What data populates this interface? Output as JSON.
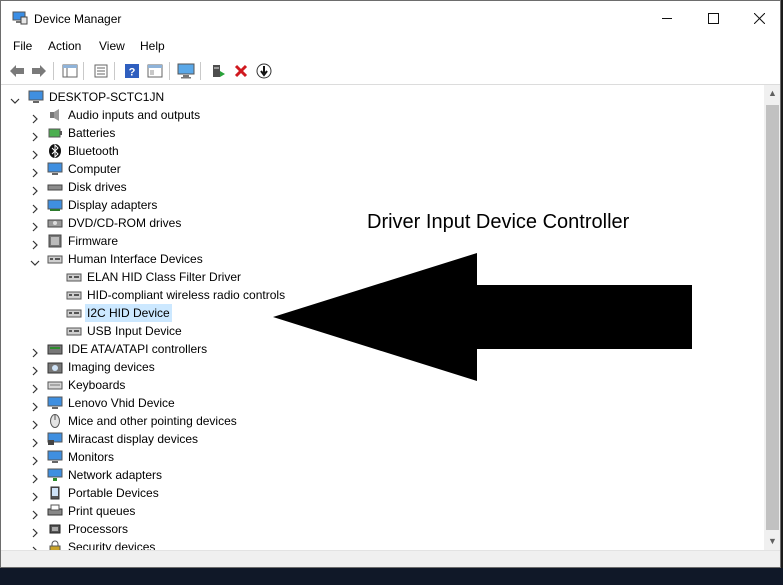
{
  "window": {
    "title": "Device Manager"
  },
  "menu": [
    "File",
    "Action",
    "View",
    "Help"
  ],
  "tree": {
    "root": "DESKTOP-SCTC1JN",
    "categories": [
      {
        "label": "Audio inputs and outputs",
        "icon": "speaker-icon"
      },
      {
        "label": "Batteries",
        "icon": "battery-icon"
      },
      {
        "label": "Bluetooth",
        "icon": "bluetooth-icon"
      },
      {
        "label": "Computer",
        "icon": "computer-icon"
      },
      {
        "label": "Disk drives",
        "icon": "disk-icon"
      },
      {
        "label": "Display adapters",
        "icon": "display-adapter-icon"
      },
      {
        "label": "DVD/CD-ROM drives",
        "icon": "dvd-icon"
      },
      {
        "label": "Firmware",
        "icon": "firmware-icon"
      },
      {
        "label": "Human Interface Devices",
        "icon": "hid-icon",
        "expanded": true,
        "children": [
          {
            "label": "ELAN HID Class Filter Driver"
          },
          {
            "label": "HID-compliant wireless radio controls"
          },
          {
            "label": "I2C HID Device",
            "selected": true
          },
          {
            "label": "USB Input Device"
          }
        ]
      },
      {
        "label": "IDE ATA/ATAPI controllers",
        "icon": "ide-icon"
      },
      {
        "label": "Imaging devices",
        "icon": "camera-icon"
      },
      {
        "label": "Keyboards",
        "icon": "keyboard-icon"
      },
      {
        "label": "Lenovo Vhid Device",
        "icon": "display-icon"
      },
      {
        "label": "Mice and other pointing devices",
        "icon": "mouse-icon"
      },
      {
        "label": "Miracast display devices",
        "icon": "miracast-icon"
      },
      {
        "label": "Monitors",
        "icon": "monitor-icon"
      },
      {
        "label": "Network adapters",
        "icon": "network-icon"
      },
      {
        "label": "Portable Devices",
        "icon": "portable-icon"
      },
      {
        "label": "Print queues",
        "icon": "printer-icon"
      },
      {
        "label": "Processors",
        "icon": "processor-icon"
      },
      {
        "label": "Security devices",
        "icon": "security-icon"
      }
    ]
  },
  "annotation": {
    "text": "Driver Input Device Controller"
  },
  "colors": {
    "selection": "#cce8ff",
    "icon_blue": "#2e7ed6",
    "arrow": "#000000"
  }
}
